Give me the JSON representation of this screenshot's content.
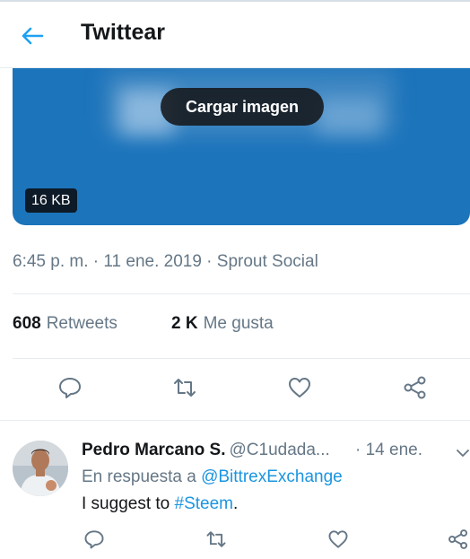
{
  "header": {
    "title": "Twittear",
    "back_icon": "back-arrow-icon",
    "accent": "#1da1f2"
  },
  "media": {
    "load_label": "Cargar imagen",
    "size": "16 KB",
    "color": "#1c74bb"
  },
  "tweet": {
    "timestamp": "6:45 p. m. · 11 ene. 2019 · ",
    "source": "Sprout Social",
    "retweets": {
      "count": "608",
      "label": "Retweets"
    },
    "likes": {
      "count": "2 K",
      "label": "Me gusta"
    }
  },
  "actions": [
    "reply-icon",
    "retweet-icon",
    "like-icon",
    "share-icon"
  ],
  "reply": {
    "name": "Pedro Marcano S.",
    "handle": "@C1udada...",
    "date": "· 14 ene.",
    "replying_prefix": "En respuesta a ",
    "replying_to": "@BittrexExchange",
    "text_prefix": "I suggest to ",
    "hashtag": "#Steem",
    "text_suffix": "."
  }
}
